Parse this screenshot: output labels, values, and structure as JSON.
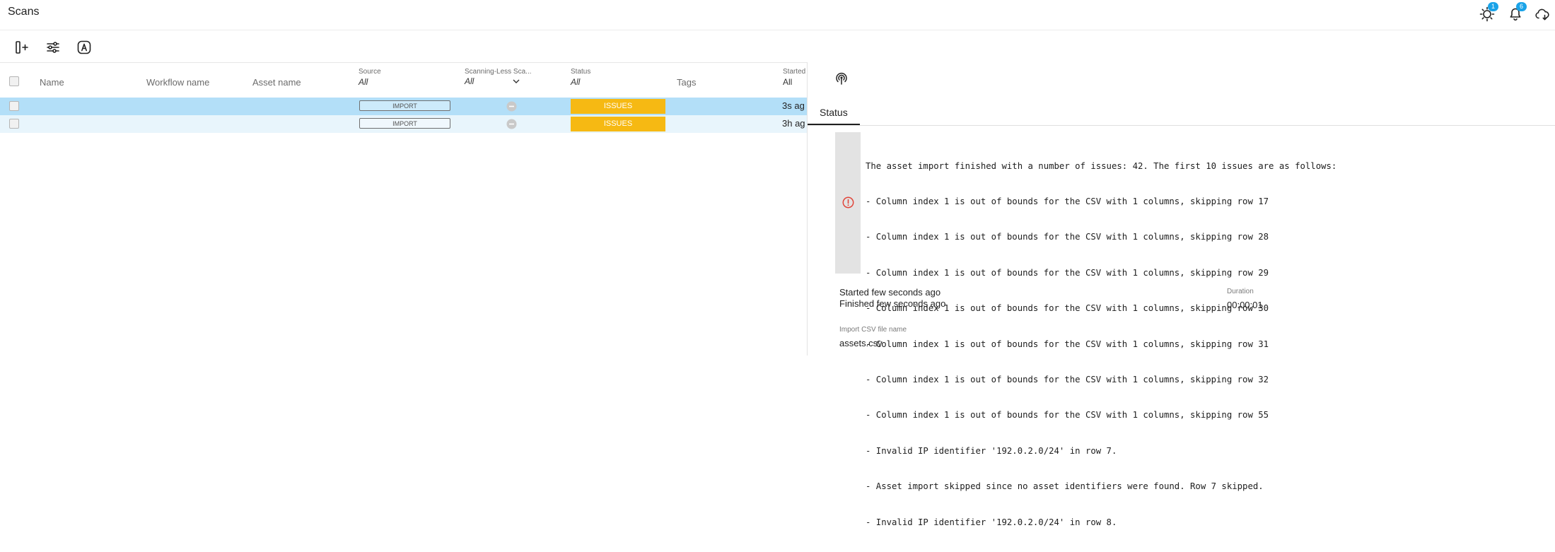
{
  "app": {
    "title": "Scans"
  },
  "topbar": {
    "icons": [
      {
        "name": "sun-settings-icon",
        "badge": "1"
      },
      {
        "name": "bell-icon",
        "badge": "6"
      },
      {
        "name": "cloud-icon",
        "badge": ""
      }
    ]
  },
  "toolbar": {
    "icons": [
      "add-panel-icon",
      "sliders-icon",
      "a-badge-icon"
    ]
  },
  "table": {
    "columns": {
      "name": "Name",
      "workflow": "Workflow name",
      "asset": "Asset name",
      "source": "Source",
      "source_filter": "All",
      "scanningless": "Scanning-Less Sca...",
      "scanningless_filter": "All",
      "status": "Status",
      "status_filter": "All",
      "tags": "Tags",
      "started": "Started",
      "started_filter": "All"
    },
    "rows": [
      {
        "source": "IMPORT",
        "status": "ISSUES",
        "started": "3s ag",
        "selected": true
      },
      {
        "source": "IMPORT",
        "status": "ISSUES",
        "started": "3h ag",
        "selected": false
      }
    ]
  },
  "panel": {
    "tab": "Status",
    "issues": [
      "The asset import finished with a number of issues: 42. The first 10 issues are as follows:",
      "- Column index 1 is out of bounds for the CSV with 1 columns, skipping row 17",
      "- Column index 1 is out of bounds for the CSV with 1 columns, skipping row 28",
      "- Column index 1 is out of bounds for the CSV with 1 columns, skipping row 29",
      "- Column index 1 is out of bounds for the CSV with 1 columns, skipping row 30",
      "- Column index 1 is out of bounds for the CSV with 1 columns, skipping row 31",
      "- Column index 1 is out of bounds for the CSV with 1 columns, skipping row 32",
      "- Column index 1 is out of bounds for the CSV with 1 columns, skipping row 55",
      "- Invalid IP identifier '192.0.2.0/24' in row 7.",
      "- Asset import skipped since no asset identifiers were found. Row 7 skipped.",
      "- Invalid IP identifier '192.0.2.0/24' in row 8."
    ],
    "started": "Started few seconds ago",
    "finished": "Finished few seconds ago",
    "duration_label": "Duration",
    "duration": "00:00:01",
    "file_label": "Import CSV file name",
    "file": "assets.csv"
  },
  "colors": {
    "selected_row": "#b3dff8",
    "alt_row": "#e8f5fc",
    "issues": "#f6b913",
    "badge": "#1aa3e8",
    "error": "#e0453a"
  }
}
